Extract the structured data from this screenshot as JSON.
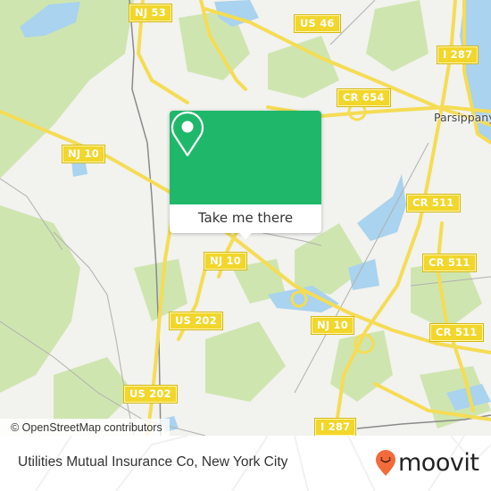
{
  "map": {
    "road_shields": [
      {
        "label": "NJ 53"
      },
      {
        "label": "US 46"
      },
      {
        "label": "I 287"
      },
      {
        "label": "CR 654"
      },
      {
        "label": "NJ 10"
      },
      {
        "label": "CR 511"
      },
      {
        "label": "NJ 10"
      },
      {
        "label": "CR 511"
      },
      {
        "label": "US 202"
      },
      {
        "label": "NJ 10"
      },
      {
        "label": "CR 511"
      },
      {
        "label": "US 202"
      },
      {
        "label": "I 287"
      }
    ],
    "place_labels": [
      {
        "label": "Parsippany-Troy Hills"
      }
    ],
    "attribution": "© OpenStreetMap contributors",
    "colors": {
      "land": "#f2f2ee",
      "park": "#cfe5b0",
      "water": "#a9d3ee",
      "road": "#f5dc55",
      "shield": "#f2d62a"
    }
  },
  "popup": {
    "pin_icon": "map-pin-icon",
    "button_label": "Take me there",
    "accent_color": "#1fb86a"
  },
  "footer": {
    "title": "Utilities Mutual Insurance Co, New York City",
    "brand": "moovit",
    "brand_color": "#f26b3a"
  }
}
